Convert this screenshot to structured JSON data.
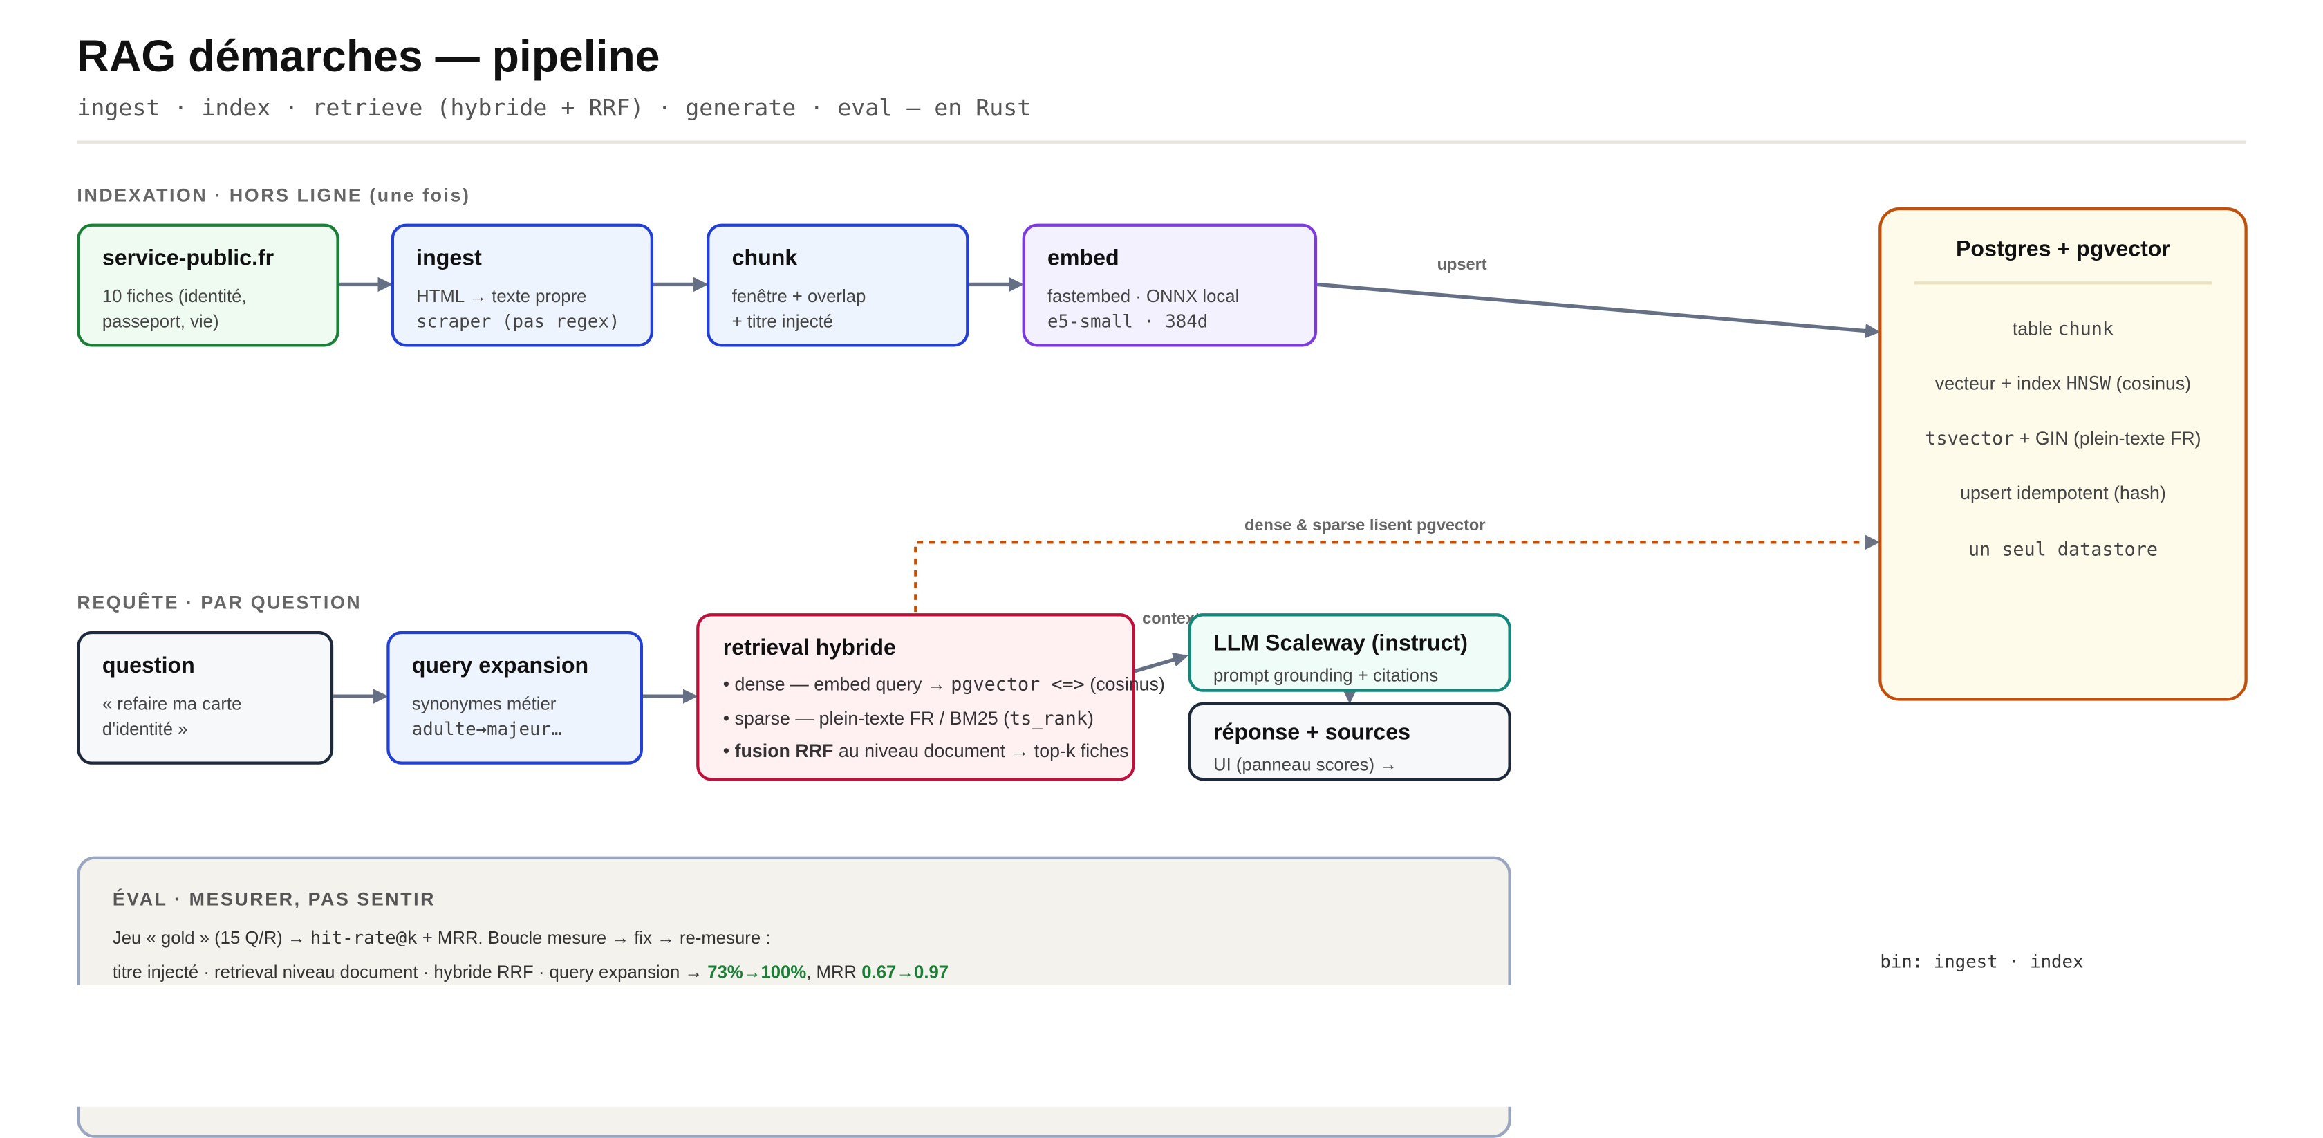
{
  "header": {
    "title": "RAG démarches — pipeline",
    "subtitle": "ingest · index · retrieve (hybride + RRF) · generate · eval — en Rust"
  },
  "sections": {
    "indexing": "INDEXATION · HORS LIGNE (une fois)",
    "query": "REQUÊTE · PAR QUESTION"
  },
  "nodes": {
    "source": {
      "title": "service-public.fr",
      "line1": "10 fiches (identité,",
      "line2": "passeport, vie)"
    },
    "ingest": {
      "title": "ingest",
      "line1": "HTML → texte propre",
      "line2": "scraper (pas regex)"
    },
    "chunk": {
      "title": "chunk",
      "line1": "fenêtre + overlap",
      "line2": "+ titre injecté"
    },
    "embed": {
      "title": "embed",
      "line1": "fastembed · ONNX local",
      "line2": "e5-small · 384d"
    },
    "question": {
      "title": "question",
      "line1": "« refaire ma carte",
      "line2": "d'identité »"
    },
    "expansion": {
      "title": "query expansion",
      "line1": "synonymes métier",
      "line2": "adulte→majeur…"
    },
    "retrieval": {
      "title": "retrieval hybride",
      "dense_pre": "• dense — embed query → ",
      "dense_code": "pgvector <=>",
      "dense_post": " (cosinus)",
      "sparse_pre": "• sparse — plein-texte FR / BM25 (",
      "sparse_code": "ts_rank",
      "sparse_post": ")",
      "fusion_bullet": "• ",
      "fusion_bold": "fusion RRF",
      "fusion_post": " au niveau document → top-k fiches"
    },
    "llm": {
      "title": "LLM Scaleway (instruct)",
      "line1": "prompt grounding + citations"
    },
    "answer": {
      "title": "réponse + sources",
      "line1": "UI (panneau scores) →"
    }
  },
  "datastore": {
    "title": "Postgres + pgvector",
    "i1_pre": "table ",
    "i1_code": "chunk",
    "i2_pre": "vecteur + index ",
    "i2_code": "HNSW",
    "i2_post": " (cosinus)",
    "i3_code": "tsvector",
    "i3_post": " + GIN (plein-texte FR)",
    "i4": "upsert idempotent (hash)",
    "i5": "un seul datastore"
  },
  "edges": {
    "upsert": "upsert",
    "dense_sparse": "dense & sparse lisent pgvector",
    "contexte": "contexte"
  },
  "eval": {
    "title": "ÉVAL · MESURER, PAS SENTIR",
    "l1_pre": "Jeu « gold » (15 Q/R) → ",
    "l1_code": "hit-rate@k",
    "l1_post": " + MRR. Boucle mesure → fix → re-mesure :",
    "l2_pre": "titre injecté · retrieval niveau document · hybride RRF · query expansion → ",
    "l2_hit": "73%→100%",
    "l2_mid": ", MRR ",
    "l2_mrr": "0.67→0.97"
  },
  "footer": {
    "bin": "bin: ingest · index"
  },
  "colors": {
    "arrow": "#667085",
    "green": "#1a7f37",
    "blue": "#2340d6",
    "purple": "#7c3ae0",
    "crimson": "#c0103c",
    "teal": "#12897a",
    "orange": "#c2500a",
    "dark": "#1e293b"
  }
}
